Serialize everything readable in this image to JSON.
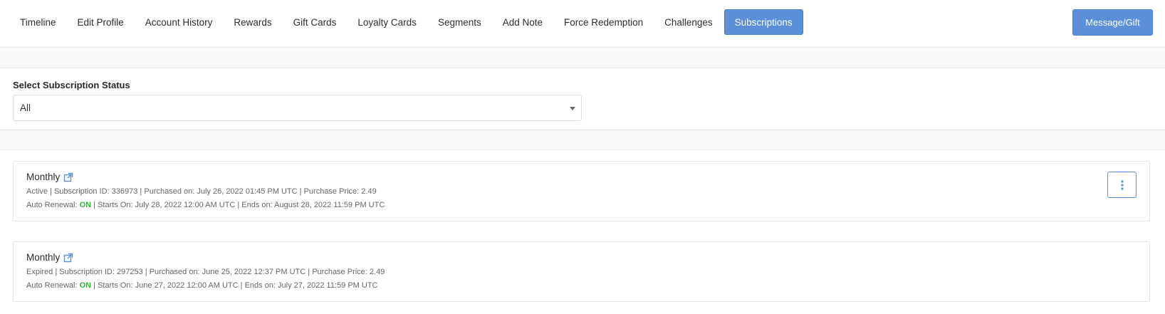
{
  "tabs": [
    {
      "label": "Timeline"
    },
    {
      "label": "Edit Profile"
    },
    {
      "label": "Account History"
    },
    {
      "label": "Rewards"
    },
    {
      "label": "Gift Cards"
    },
    {
      "label": "Loyalty Cards"
    },
    {
      "label": "Segments"
    },
    {
      "label": "Add Note"
    },
    {
      "label": "Force Redemption"
    },
    {
      "label": "Challenges"
    },
    {
      "label": "Subscriptions",
      "active": true
    }
  ],
  "message_button": "Message/Gift",
  "filter": {
    "label": "Select Subscription Status",
    "selected": "All"
  },
  "subscriptions": [
    {
      "title": "Monthly",
      "status": "Active",
      "subscription_id": "Subscription ID: 336973",
      "purchased": "Purchased on: July 26, 2022 01:45 PM UTC",
      "price": "Purchase Price: 2.49",
      "auto_renewal_label": "Auto Renewal:",
      "auto_renewal_value": "ON",
      "starts": "Starts On: July 28, 2022 12:00 AM UTC",
      "ends": "Ends on: August 28, 2022 11:59 PM UTC"
    },
    {
      "title": "Monthly",
      "status": "Expired",
      "subscription_id": "Subscription ID: 297253",
      "purchased": "Purchased on: June 25, 2022 12:37 PM UTC",
      "price": "Purchase Price: 2.49",
      "auto_renewal_label": "Auto Renewal:",
      "auto_renewal_value": "ON",
      "starts": "Starts On: June 27, 2022 12:00 AM UTC",
      "ends": "Ends on: July 27, 2022 11:59 PM UTC"
    }
  ],
  "separator": " | ",
  "icons": {
    "external_link": "external-link-icon",
    "more": "vertical-ellipsis-icon",
    "dropdown": "chevron-down-icon"
  },
  "colors": {
    "accent": "#5b8fd9",
    "on_status": "#2dbb2d"
  }
}
